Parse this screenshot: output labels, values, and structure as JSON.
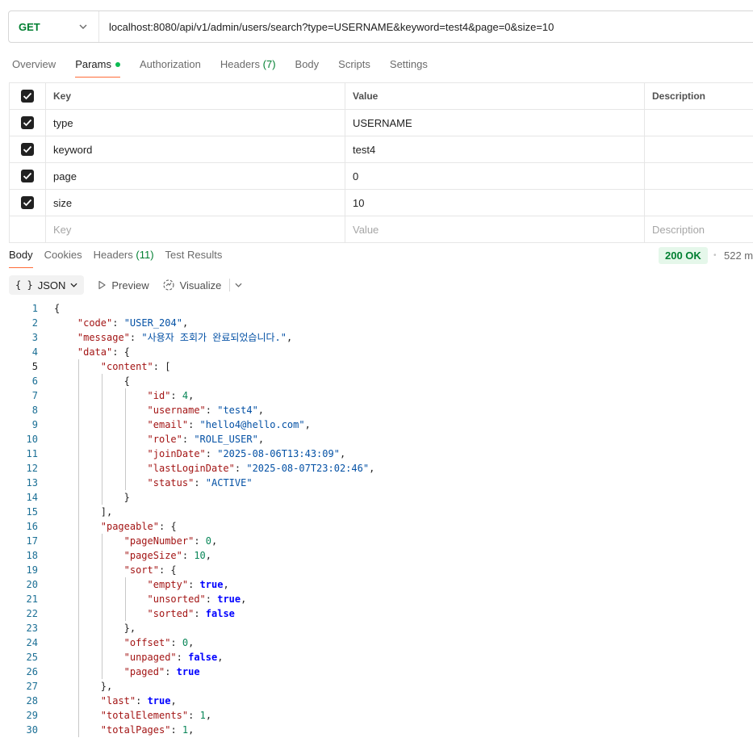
{
  "request": {
    "method": "GET",
    "url": "localhost:8080/api/v1/admin/users/search?type=USERNAME&keyword=test4&page=0&size=10"
  },
  "request_tabs": [
    {
      "label": "Overview"
    },
    {
      "label": "Params"
    },
    {
      "label": "Authorization"
    },
    {
      "label": "Headers",
      "count": "(7)"
    },
    {
      "label": "Body"
    },
    {
      "label": "Scripts"
    },
    {
      "label": "Settings"
    }
  ],
  "params": {
    "headers": {
      "key": "Key",
      "value": "Value",
      "description": "Description"
    },
    "rows": [
      {
        "key": "type",
        "value": "USERNAME"
      },
      {
        "key": "keyword",
        "value": "test4"
      },
      {
        "key": "page",
        "value": "0"
      },
      {
        "key": "size",
        "value": "10"
      }
    ],
    "placeholder": {
      "key": "Key",
      "value": "Value",
      "description": "Description"
    }
  },
  "response_tabs": [
    {
      "label": "Body"
    },
    {
      "label": "Cookies"
    },
    {
      "label": "Headers",
      "count": "(11)"
    },
    {
      "label": "Test Results"
    }
  ],
  "response_status": {
    "status": "200 OK",
    "time": "522 m"
  },
  "body_toolbar": {
    "format": "JSON",
    "preview": "Preview",
    "visualize": "Visualize"
  },
  "colors": {
    "method_get": "#007f31",
    "active_tab_underline": "#ff6c37",
    "status_ok_bg": "#e5f7ea"
  },
  "response_body": [
    {
      "n": "1",
      "ind": 0,
      "t": [
        [
          "p",
          "{"
        ]
      ]
    },
    {
      "n": "2",
      "ind": 1,
      "t": [
        [
          "k",
          "\"code\""
        ],
        [
          "p",
          ": "
        ],
        [
          "s",
          "\"USER_204\""
        ],
        [
          "p",
          ","
        ]
      ]
    },
    {
      "n": "3",
      "ind": 1,
      "t": [
        [
          "k",
          "\"message\""
        ],
        [
          "p",
          ": "
        ],
        [
          "s",
          "\"사용자 조회가 완료되었습니다.\""
        ],
        [
          "p",
          ","
        ]
      ]
    },
    {
      "n": "4",
      "ind": 1,
      "t": [
        [
          "k",
          "\"data\""
        ],
        [
          "p",
          ": {"
        ]
      ]
    },
    {
      "n": "5",
      "ind": 2,
      "t": [
        [
          "k",
          "\"content\""
        ],
        [
          "p",
          ": ["
        ]
      ]
    },
    {
      "n": "6",
      "ind": 3,
      "t": [
        [
          "p",
          "{"
        ]
      ]
    },
    {
      "n": "7",
      "ind": 4,
      "t": [
        [
          "k",
          "\"id\""
        ],
        [
          "p",
          ": "
        ],
        [
          "n",
          "4"
        ],
        [
          "p",
          ","
        ]
      ]
    },
    {
      "n": "8",
      "ind": 4,
      "t": [
        [
          "k",
          "\"username\""
        ],
        [
          "p",
          ": "
        ],
        [
          "s",
          "\"test4\""
        ],
        [
          "p",
          ","
        ]
      ]
    },
    {
      "n": "9",
      "ind": 4,
      "t": [
        [
          "k",
          "\"email\""
        ],
        [
          "p",
          ": "
        ],
        [
          "s",
          "\"hello4@hello.com\""
        ],
        [
          "p",
          ","
        ]
      ]
    },
    {
      "n": "10",
      "ind": 4,
      "t": [
        [
          "k",
          "\"role\""
        ],
        [
          "p",
          ": "
        ],
        [
          "s",
          "\"ROLE_USER\""
        ],
        [
          "p",
          ","
        ]
      ]
    },
    {
      "n": "11",
      "ind": 4,
      "t": [
        [
          "k",
          "\"joinDate\""
        ],
        [
          "p",
          ": "
        ],
        [
          "s",
          "\"2025-08-06T13:43:09\""
        ],
        [
          "p",
          ","
        ]
      ]
    },
    {
      "n": "12",
      "ind": 4,
      "t": [
        [
          "k",
          "\"lastLoginDate\""
        ],
        [
          "p",
          ": "
        ],
        [
          "s",
          "\"2025-08-07T23:02:46\""
        ],
        [
          "p",
          ","
        ]
      ]
    },
    {
      "n": "13",
      "ind": 4,
      "t": [
        [
          "k",
          "\"status\""
        ],
        [
          "p",
          ": "
        ],
        [
          "s",
          "\"ACTIVE\""
        ]
      ]
    },
    {
      "n": "14",
      "ind": 3,
      "t": [
        [
          "p",
          "}"
        ]
      ]
    },
    {
      "n": "15",
      "ind": 2,
      "t": [
        [
          "p",
          "],"
        ]
      ]
    },
    {
      "n": "16",
      "ind": 2,
      "t": [
        [
          "k",
          "\"pageable\""
        ],
        [
          "p",
          ": {"
        ]
      ]
    },
    {
      "n": "17",
      "ind": 3,
      "t": [
        [
          "k",
          "\"pageNumber\""
        ],
        [
          "p",
          ": "
        ],
        [
          "n",
          "0"
        ],
        [
          "p",
          ","
        ]
      ]
    },
    {
      "n": "18",
      "ind": 3,
      "t": [
        [
          "k",
          "\"pageSize\""
        ],
        [
          "p",
          ": "
        ],
        [
          "n",
          "10"
        ],
        [
          "p",
          ","
        ]
      ]
    },
    {
      "n": "19",
      "ind": 3,
      "t": [
        [
          "k",
          "\"sort\""
        ],
        [
          "p",
          ": {"
        ]
      ]
    },
    {
      "n": "20",
      "ind": 4,
      "t": [
        [
          "k",
          "\"empty\""
        ],
        [
          "p",
          ": "
        ],
        [
          "b",
          "true"
        ],
        [
          "p",
          ","
        ]
      ]
    },
    {
      "n": "21",
      "ind": 4,
      "t": [
        [
          "k",
          "\"unsorted\""
        ],
        [
          "p",
          ": "
        ],
        [
          "b",
          "true"
        ],
        [
          "p",
          ","
        ]
      ]
    },
    {
      "n": "22",
      "ind": 4,
      "t": [
        [
          "k",
          "\"sorted\""
        ],
        [
          "p",
          ": "
        ],
        [
          "b",
          "false"
        ]
      ]
    },
    {
      "n": "23",
      "ind": 3,
      "t": [
        [
          "p",
          "},"
        ]
      ]
    },
    {
      "n": "24",
      "ind": 3,
      "t": [
        [
          "k",
          "\"offset\""
        ],
        [
          "p",
          ": "
        ],
        [
          "n",
          "0"
        ],
        [
          "p",
          ","
        ]
      ]
    },
    {
      "n": "25",
      "ind": 3,
      "t": [
        [
          "k",
          "\"unpaged\""
        ],
        [
          "p",
          ": "
        ],
        [
          "b",
          "false"
        ],
        [
          "p",
          ","
        ]
      ]
    },
    {
      "n": "26",
      "ind": 3,
      "t": [
        [
          "k",
          "\"paged\""
        ],
        [
          "p",
          ": "
        ],
        [
          "b",
          "true"
        ]
      ]
    },
    {
      "n": "27",
      "ind": 2,
      "t": [
        [
          "p",
          "},"
        ]
      ]
    },
    {
      "n": "28",
      "ind": 2,
      "t": [
        [
          "k",
          "\"last\""
        ],
        [
          "p",
          ": "
        ],
        [
          "b",
          "true"
        ],
        [
          "p",
          ","
        ]
      ]
    },
    {
      "n": "29",
      "ind": 2,
      "t": [
        [
          "k",
          "\"totalElements\""
        ],
        [
          "p",
          ": "
        ],
        [
          "n",
          "1"
        ],
        [
          "p",
          ","
        ]
      ]
    },
    {
      "n": "30",
      "ind": 2,
      "t": [
        [
          "k",
          "\"totalPages\""
        ],
        [
          "p",
          ": "
        ],
        [
          "n",
          "1"
        ],
        [
          "p",
          ","
        ]
      ]
    }
  ]
}
